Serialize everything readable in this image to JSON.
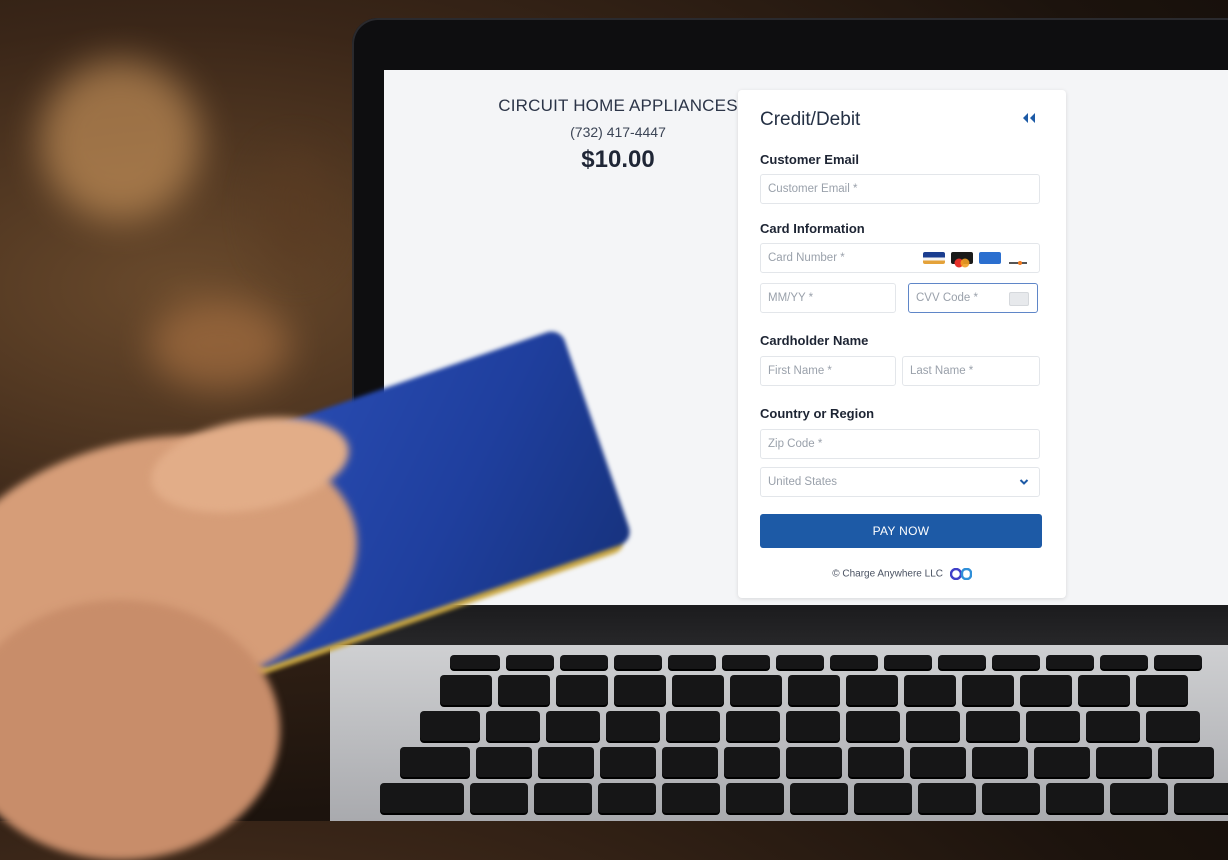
{
  "merchant": {
    "name": "CIRCUIT HOME APPLIANCES",
    "phone": "(732) 417-4447",
    "amount": "$10.00"
  },
  "payment_panel": {
    "title": "Credit/Debit",
    "collapse_icon": "double-chevron-left-icon",
    "sections": {
      "email": "Customer Email",
      "card": "Card Information",
      "cardholder": "Cardholder Name",
      "country": "Country or Region"
    },
    "fields": {
      "email_placeholder": "Customer Email *",
      "card_number_placeholder": "Card Number *",
      "expiry_placeholder": "MM/YY *",
      "cvv_placeholder": "CVV Code *",
      "first_name_placeholder": "First Name *",
      "last_name_placeholder": "Last Name *",
      "zip_placeholder": "Zip Code *",
      "country_selected": "United States"
    },
    "card_brands": [
      "visa-icon",
      "mastercard-icon",
      "amex-icon",
      "discover-icon"
    ],
    "pay_button_label": "PAY NOW",
    "footer": "© Charge Anywhere LLC"
  },
  "colors": {
    "primary": "#1d5aa6",
    "focus_border": "#5f86c8",
    "title_text": "#243044"
  }
}
